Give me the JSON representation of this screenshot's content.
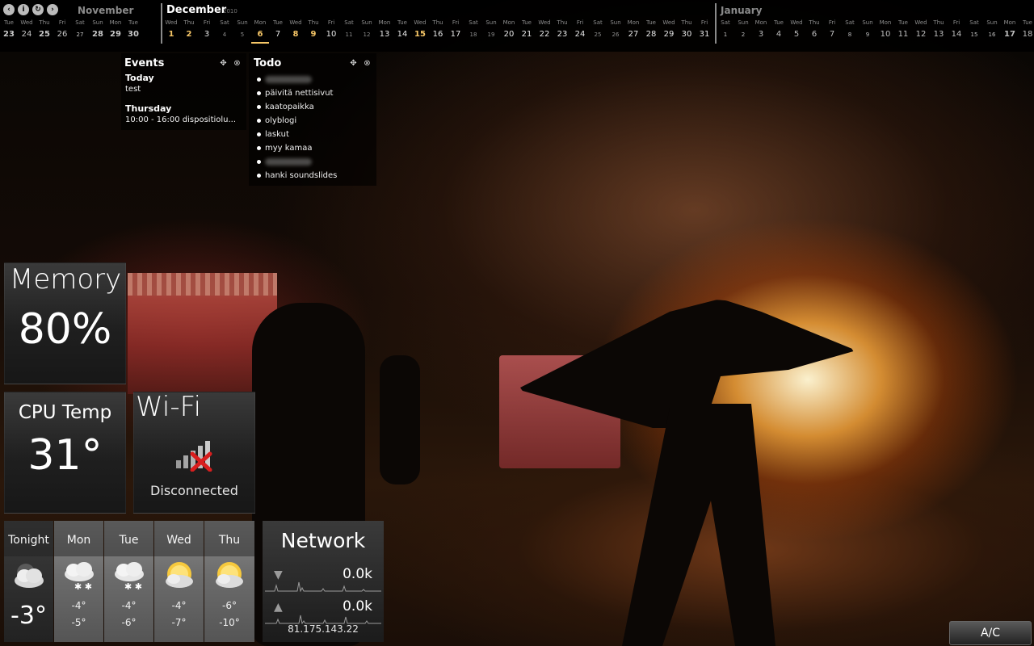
{
  "calendar": {
    "nav_icons": [
      "prev-icon",
      "info-icon",
      "refresh-icon",
      "next-icon"
    ],
    "months": [
      {
        "name": "November",
        "year": "",
        "state": "past",
        "days": [
          {
            "dow": "Tue",
            "num": "23",
            "style": "hl"
          },
          {
            "dow": "Wed",
            "num": "24",
            "style": ""
          },
          {
            "dow": "Thu",
            "num": "25",
            "style": "hl"
          },
          {
            "dow": "Fri",
            "num": "26",
            "style": ""
          },
          {
            "dow": "Sat",
            "num": "27",
            "style": "dim"
          },
          {
            "dow": "Sun",
            "num": "28",
            "style": "hl"
          },
          {
            "dow": "Mon",
            "num": "29",
            "style": "hl"
          },
          {
            "dow": "Tue",
            "num": "30",
            "style": "hl"
          }
        ]
      },
      {
        "name": "December",
        "year": "2010",
        "state": "current",
        "days": [
          {
            "dow": "Wed",
            "num": "1",
            "style": "hl"
          },
          {
            "dow": "Thu",
            "num": "2",
            "style": "hl"
          },
          {
            "dow": "Fri",
            "num": "3",
            "style": ""
          },
          {
            "dow": "Sat",
            "num": "4",
            "style": "dim"
          },
          {
            "dow": "Sun",
            "num": "5",
            "style": "dim"
          },
          {
            "dow": "Mon",
            "num": "6",
            "style": "today"
          },
          {
            "dow": "Tue",
            "num": "7",
            "style": ""
          },
          {
            "dow": "Wed",
            "num": "8",
            "style": "hl"
          },
          {
            "dow": "Thu",
            "num": "9",
            "style": "hl"
          },
          {
            "dow": "Fri",
            "num": "10",
            "style": ""
          },
          {
            "dow": "Sat",
            "num": "11",
            "style": "dim"
          },
          {
            "dow": "Sun",
            "num": "12",
            "style": "dim"
          },
          {
            "dow": "Mon",
            "num": "13",
            "style": ""
          },
          {
            "dow": "Tue",
            "num": "14",
            "style": ""
          },
          {
            "dow": "Wed",
            "num": "15",
            "style": "hl"
          },
          {
            "dow": "Thu",
            "num": "16",
            "style": ""
          },
          {
            "dow": "Fri",
            "num": "17",
            "style": ""
          },
          {
            "dow": "Sat",
            "num": "18",
            "style": "dim"
          },
          {
            "dow": "Sun",
            "num": "19",
            "style": "dim"
          },
          {
            "dow": "Mon",
            "num": "20",
            "style": ""
          },
          {
            "dow": "Tue",
            "num": "21",
            "style": ""
          },
          {
            "dow": "Wed",
            "num": "22",
            "style": ""
          },
          {
            "dow": "Thu",
            "num": "23",
            "style": ""
          },
          {
            "dow": "Fri",
            "num": "24",
            "style": ""
          },
          {
            "dow": "Sat",
            "num": "25",
            "style": "dim"
          },
          {
            "dow": "Sun",
            "num": "26",
            "style": "dim"
          },
          {
            "dow": "Mon",
            "num": "27",
            "style": ""
          },
          {
            "dow": "Tue",
            "num": "28",
            "style": ""
          },
          {
            "dow": "Wed",
            "num": "29",
            "style": ""
          },
          {
            "dow": "Thu",
            "num": "30",
            "style": ""
          },
          {
            "dow": "Fri",
            "num": "31",
            "style": ""
          }
        ]
      },
      {
        "name": "January",
        "year": "",
        "state": "future",
        "days": [
          {
            "dow": "Sat",
            "num": "1",
            "style": "dim"
          },
          {
            "dow": "Sun",
            "num": "2",
            "style": "dim"
          },
          {
            "dow": "Mon",
            "num": "3",
            "style": ""
          },
          {
            "dow": "Tue",
            "num": "4",
            "style": ""
          },
          {
            "dow": "Wed",
            "num": "5",
            "style": ""
          },
          {
            "dow": "Thu",
            "num": "6",
            "style": ""
          },
          {
            "dow": "Fri",
            "num": "7",
            "style": ""
          },
          {
            "dow": "Sat",
            "num": "8",
            "style": "dim"
          },
          {
            "dow": "Sun",
            "num": "9",
            "style": "dim"
          },
          {
            "dow": "Mon",
            "num": "10",
            "style": ""
          },
          {
            "dow": "Tue",
            "num": "11",
            "style": ""
          },
          {
            "dow": "Wed",
            "num": "12",
            "style": ""
          },
          {
            "dow": "Thu",
            "num": "13",
            "style": ""
          },
          {
            "dow": "Fri",
            "num": "14",
            "style": ""
          },
          {
            "dow": "Sat",
            "num": "15",
            "style": "dim"
          },
          {
            "dow": "Sun",
            "num": "16",
            "style": "dim"
          },
          {
            "dow": "Mon",
            "num": "17",
            "style": "hl"
          },
          {
            "dow": "Tue",
            "num": "18",
            "style": ""
          }
        ]
      }
    ]
  },
  "events": {
    "title": "Events",
    "controls": [
      "move-icon",
      "close-icon"
    ],
    "groups": [
      {
        "day": "Today",
        "text": "test"
      },
      {
        "day": "Thursday",
        "text": "10:00 - 16:00 dispositiolu..."
      }
    ]
  },
  "todo": {
    "title": "Todo",
    "controls": [
      "move-icon",
      "close-icon"
    ],
    "items": [
      {
        "text": "",
        "redacted": true
      },
      {
        "text": "päivitä nettisivut",
        "redacted": false
      },
      {
        "text": "kaatopaikka",
        "redacted": false
      },
      {
        "text": "olyblogi",
        "redacted": false
      },
      {
        "text": "laskut",
        "redacted": false
      },
      {
        "text": "myy kamaa",
        "redacted": false
      },
      {
        "text": "",
        "redacted": true
      },
      {
        "text": "hanki soundslides",
        "redacted": false
      }
    ]
  },
  "memory": {
    "title": "Memory",
    "value": "80%"
  },
  "cpu": {
    "title": "CPU Temp",
    "value": "31°"
  },
  "wifi": {
    "title": "Wi-Fi",
    "status": "Disconnected",
    "icon": "wifi-signal-disconnected-icon"
  },
  "weather": {
    "columns": [
      {
        "label": "Tonight",
        "icon": "cloudy-night-icon",
        "big": "-3°"
      },
      {
        "label": "Mon",
        "icon": "snow-cloud-icon",
        "hi": "-4°",
        "lo": "-5°"
      },
      {
        "label": "Tue",
        "icon": "snow-cloud-icon",
        "hi": "-4°",
        "lo": "-6°"
      },
      {
        "label": "Wed",
        "icon": "sun-cloud-icon",
        "hi": "-4°",
        "lo": "-7°"
      },
      {
        "label": "Thu",
        "icon": "sun-cloud-icon",
        "hi": "-6°",
        "lo": "-10°"
      }
    ]
  },
  "network": {
    "title": "Network",
    "download": "0.0k",
    "upload": "0.0k",
    "ip": "81.175.143.22"
  },
  "ac_button": {
    "label": "A/C"
  },
  "colors": {
    "highlight": "#f6c667",
    "tile_dark": "#1f1f1f",
    "tile_light": "#3a3a3a"
  }
}
